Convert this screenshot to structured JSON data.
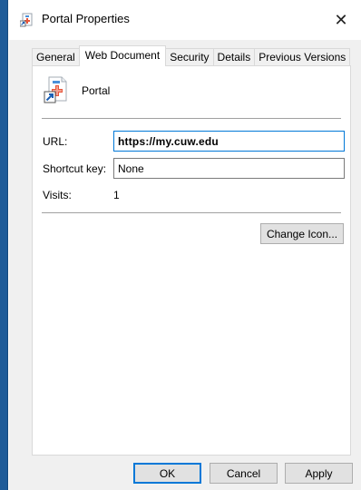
{
  "window": {
    "title": "Portal Properties",
    "close_label": "✕",
    "icon": "internet-shortcut-icon"
  },
  "tabs": [
    {
      "label": "General",
      "active": false
    },
    {
      "label": "Web Document",
      "active": true
    },
    {
      "label": "Security",
      "active": false
    },
    {
      "label": "Details",
      "active": false
    },
    {
      "label": "Previous Versions",
      "active": false
    }
  ],
  "document": {
    "name": "Portal",
    "icon": "web-document-icon"
  },
  "fields": {
    "url_label": "URL:",
    "url_value": "https://my.cuw.edu",
    "shortcut_label": "Shortcut key:",
    "shortcut_value": "None",
    "visits_label": "Visits:",
    "visits_value": "1"
  },
  "buttons": {
    "change_icon": "Change Icon...",
    "ok": "OK",
    "cancel": "Cancel",
    "apply": "Apply"
  },
  "colors": {
    "accent": "#0078d7",
    "desktop_strip": "#1f5c99",
    "dialog_bg": "#f0f0f0"
  }
}
